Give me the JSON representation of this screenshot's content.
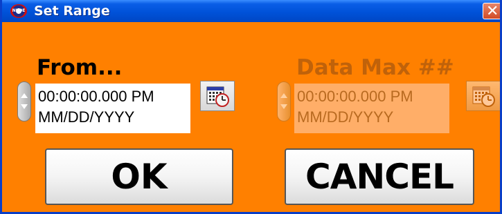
{
  "window": {
    "title": "Set Range",
    "app_icon_text": "NI-DE",
    "close_glyph": "✕"
  },
  "from": {
    "heading": "From...",
    "time": "00:00:00.000 PM",
    "date": "MM/DD/YYYY",
    "enabled": true,
    "calendar_icon": "calendar-clock-icon"
  },
  "to": {
    "heading": "Data Max ##",
    "time": "00:00:00.000 PM",
    "date": "MM/DD/YYYY",
    "enabled": false,
    "calendar_icon": "calendar-clock-icon"
  },
  "buttons": {
    "ok_label": "OK",
    "cancel_label": "CANCEL"
  },
  "colors": {
    "panel": "#ff8000",
    "titlebar": "#0052d9",
    "disabled_text": "#c0620a"
  }
}
